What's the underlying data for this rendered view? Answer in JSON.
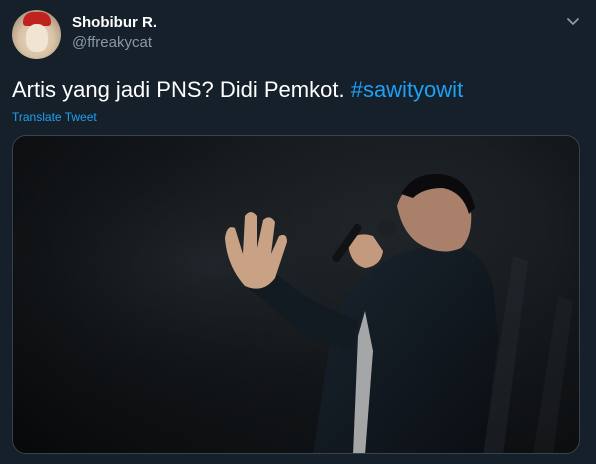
{
  "tweet": {
    "author": {
      "display_name": "Shobibur R.",
      "handle": "@ffreakycat"
    },
    "text": "Artis yang jadi PNS? Didi Pemkot. ",
    "hashtag": "#sawityowit",
    "translate_label": "Translate Tweet",
    "menu_icon": "chevron-down-icon"
  },
  "colors": {
    "background": "#15202b",
    "accent": "#1da1f2",
    "secondary_text": "#8899a6"
  }
}
